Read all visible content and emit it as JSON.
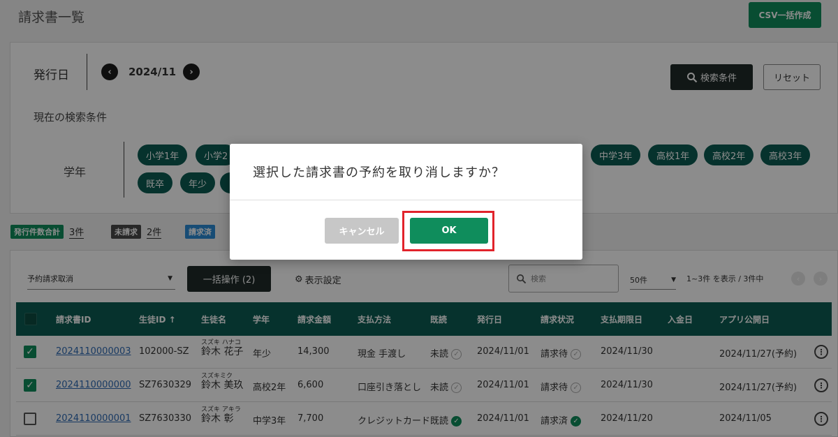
{
  "page": {
    "title": "請求書一覧",
    "csv_button": "CSV一括作成"
  },
  "search": {
    "issue_label": "発行日",
    "month": "2024/11",
    "prev_icon": "chevron-left-icon",
    "next_icon": "chevron-right-icon",
    "search_conditions_button": "検索条件",
    "reset_button": "リセット",
    "current_conditions_label": "現在の検索条件",
    "grade_label": "学年",
    "grade_chips": [
      "小学1年",
      "小学2",
      "中学3年",
      "高校1年",
      "高校2年",
      "高校3年",
      "既卒",
      "年少"
    ]
  },
  "summary": [
    {
      "tag": "発行件数合計",
      "value": "3件",
      "color": "#0f8d5c"
    },
    {
      "tag": "未請求",
      "value": "2件",
      "color": "#4a4a4a"
    },
    {
      "tag": "請求済",
      "value": "",
      "color": "#2a8ad6"
    }
  ],
  "list": {
    "action_select": "予約請求取消",
    "bulk_button": "一括操作 (2)",
    "display_settings": "表示設定",
    "search_placeholder": "検索",
    "per_page": "50件",
    "range_text": "1~3件 を表示 / 3件中",
    "columns": [
      "請求書ID",
      "生徒ID ↑",
      "生徒名",
      "学年",
      "請求金額",
      "支払方法",
      "既読",
      "発行日",
      "請求状況",
      "支払期限日",
      "入金日",
      "アプリ公開日"
    ],
    "rows": [
      {
        "checked": true,
        "invoice_id": "2024110000003",
        "student_id": "102000-SZ",
        "kana": "スズキ ハナコ",
        "name": "鈴木 花子",
        "grade": "年少",
        "amount": "14,300",
        "payment": "現金 手渡し",
        "read": "未読",
        "read_done": false,
        "issued": "2024/11/01",
        "status": "請求待",
        "status_done": false,
        "due": "2024/11/30",
        "paid": "",
        "app_date": "2024/11/27(予約)"
      },
      {
        "checked": true,
        "invoice_id": "2024110000000",
        "student_id": "SZ7630329",
        "kana": "スズキミク",
        "name": "鈴木 美玖",
        "grade": "高校2年",
        "amount": "6,600",
        "payment": "口座引き落とし",
        "read": "未読",
        "read_done": false,
        "issued": "2024/11/01",
        "status": "請求待",
        "status_done": false,
        "due": "2024/11/30",
        "paid": "",
        "app_date": "2024/11/27(予約)"
      },
      {
        "checked": false,
        "invoice_id": "2024110000001",
        "student_id": "SZ7630330",
        "kana": "スズキ アキラ",
        "name": "鈴木 彰",
        "grade": "中学3年",
        "amount": "7,700",
        "payment": "クレジットカード",
        "read": "既読",
        "read_done": true,
        "issued": "2024/11/01",
        "status": "請求済",
        "status_done": true,
        "due": "2024/11/20",
        "paid": "",
        "app_date": "2024/11/05"
      }
    ]
  },
  "modal": {
    "message": "選択した請求書の予約を取り消しますか？",
    "cancel_button": "キャンセル",
    "ok_button": "OK",
    "highlight_color": "#e1232b"
  }
}
